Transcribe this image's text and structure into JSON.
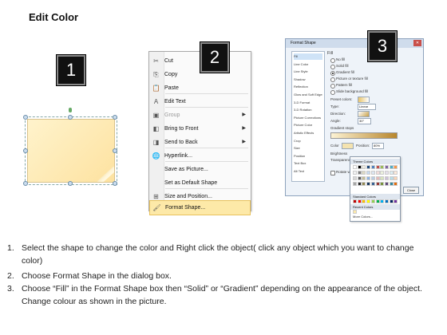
{
  "header": {
    "title": "Edit Color"
  },
  "badges": [
    "1",
    "2",
    "3"
  ],
  "context_menu": {
    "items": [
      {
        "label": "Cut",
        "icon": "scissors-icon",
        "glyph": "✂",
        "arrow": false,
        "disabled": false
      },
      {
        "label": "Copy",
        "icon": "copy-icon",
        "glyph": "⎘",
        "arrow": false,
        "disabled": false
      },
      {
        "label": "Paste",
        "icon": "paste-icon",
        "glyph": "📋",
        "arrow": false,
        "disabled": false
      },
      {
        "label": "Edit Text",
        "icon": "edit-text-icon",
        "glyph": "A",
        "arrow": false,
        "disabled": false
      },
      {
        "label": "Group",
        "icon": "group-icon",
        "glyph": "▣",
        "arrow": true,
        "disabled": true
      },
      {
        "label": "Bring to Front",
        "icon": "bring-to-front-icon",
        "glyph": "◧",
        "arrow": true,
        "disabled": false
      },
      {
        "label": "Send to Back",
        "icon": "send-to-back-icon",
        "glyph": "◨",
        "arrow": true,
        "disabled": false
      },
      {
        "label": "Hyperlink...",
        "icon": "hyperlink-icon",
        "glyph": "🌐",
        "arrow": false,
        "disabled": false
      },
      {
        "label": "Save as Picture...",
        "icon": "",
        "glyph": "",
        "arrow": false,
        "disabled": false
      },
      {
        "label": "Set as Default Shape",
        "icon": "",
        "glyph": "",
        "arrow": false,
        "disabled": false
      },
      {
        "label": "Size and Position...",
        "icon": "size-position-icon",
        "glyph": "⊞",
        "arrow": false,
        "disabled": false
      },
      {
        "label": "Format Shape...",
        "icon": "format-shape-icon",
        "glyph": "🖌",
        "arrow": false,
        "disabled": false,
        "highlighted": true
      }
    ]
  },
  "dialog": {
    "title": "Format Shape",
    "close_glyph": "✕",
    "sidebar": [
      "Fill",
      "Line Color",
      "Line Style",
      "Shadow",
      "Reflection",
      "Glow and Soft Edges",
      "3-D Format",
      "3-D Rotation",
      "Picture Corrections",
      "Picture Color",
      "Artistic Effects",
      "Crop",
      "Size",
      "Position",
      "Text Box",
      "Alt Text"
    ],
    "fill_heading": "Fill",
    "fill_options": [
      "No fill",
      "Solid fill",
      "Gradient fill",
      "Picture or texture fill",
      "Pattern fill",
      "Slide background fill"
    ],
    "fill_selected": 2,
    "labels": {
      "preset": "Preset colors:",
      "type": "Type:",
      "type_value": "Linear",
      "direction": "Direction:",
      "angle": "Angle:",
      "angle_value": "30°",
      "stops": "Gradient stops",
      "color": "Color",
      "position": "Position:",
      "position_value": "80%",
      "brightness": "Brightness",
      "transparency": "Transparency",
      "rotate": "Rotate with shape"
    },
    "close_button": "Close"
  },
  "color_popup": {
    "theme_heading": "Theme Colors",
    "standard_heading": "Standard Colors",
    "recent_heading": "Recent Colors",
    "more": "More Colors...",
    "theme_row": [
      "#ffffff",
      "#000000",
      "#eeece1",
      "#1f497d",
      "#4f81bd",
      "#c0504d",
      "#9bbb59",
      "#8064a2",
      "#4bacc6",
      "#f79646"
    ],
    "theme_tints": [
      "#f2f2f2",
      "#7f7f7f",
      "#ddd9c3",
      "#c6d9f0",
      "#dbe5f1",
      "#f2dcdb",
      "#ebf1dd",
      "#e5e0ec",
      "#dbeef3",
      "#fdeada"
    ],
    "theme_shades": [
      "#d8d8d8",
      "#595959",
      "#c4bd97",
      "#8db3e2",
      "#b8cce4",
      "#e5b9b7",
      "#d7e3bc",
      "#ccc1d9",
      "#b7dde8",
      "#fbd5b5"
    ],
    "theme_darks": [
      "#a5a5a5",
      "#262626",
      "#938953",
      "#17365d",
      "#366092",
      "#953734",
      "#76923c",
      "#5f497a",
      "#31859b",
      "#e36c09"
    ],
    "standard_row": [
      "#c00000",
      "#ff0000",
      "#ffc000",
      "#ffff00",
      "#92d050",
      "#00b050",
      "#00b0f0",
      "#0070c0",
      "#002060",
      "#7030a0"
    ],
    "recent_row": [
      "#fde9a9"
    ]
  },
  "instructions": [
    {
      "num": "1.",
      "text": "Select the shape to change the color and Right click the object( click any object which you want to change color)"
    },
    {
      "num": "2.",
      "text": "Choose Format Shape in the dialog box."
    },
    {
      "num": "3.",
      "text": "Choose “Fill” in the Format Shape box then “Solid” or “Gradient” depending on the appearance of the object. Change colour as shown in the picture."
    }
  ]
}
